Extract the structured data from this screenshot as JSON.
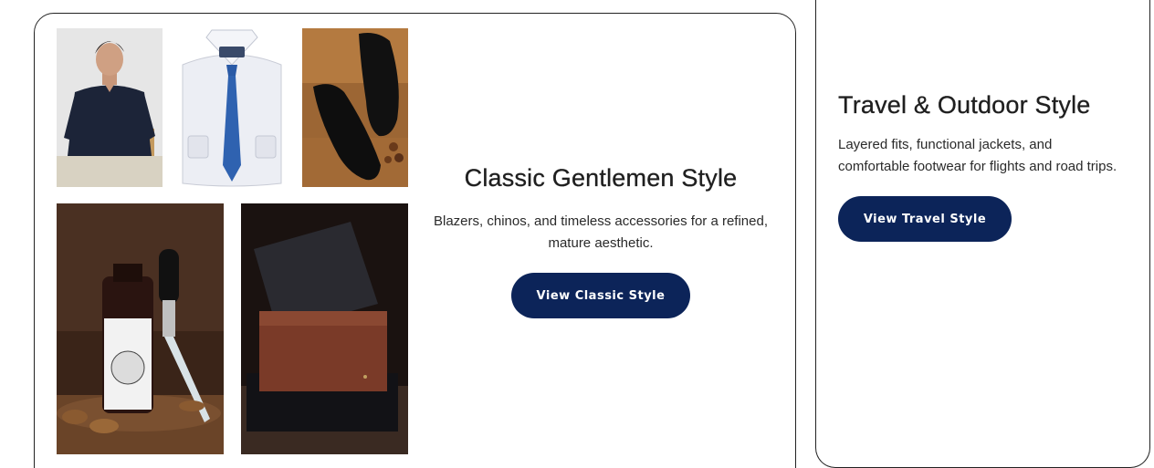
{
  "classic": {
    "title": "Classic Gentlemen Style",
    "description": "Blazers, chinos, and timeless accessories for a refined, mature aesthetic.",
    "button_label": "View Classic Style",
    "images": [
      "polo-shirt-model",
      "white-shirt-blue-tie",
      "black-brogue-shoes",
      "beard-oil-bottle",
      "leather-wallet-box"
    ]
  },
  "travel": {
    "title": "Travel & Outdoor Style",
    "description": "Layered fits, functional jackets, and comfortable footwear for flights and road trips.",
    "button_label": "View Travel Style"
  },
  "colors": {
    "button_bg": "#0c2459",
    "button_text": "#ffffff",
    "card_border": "#222222"
  }
}
